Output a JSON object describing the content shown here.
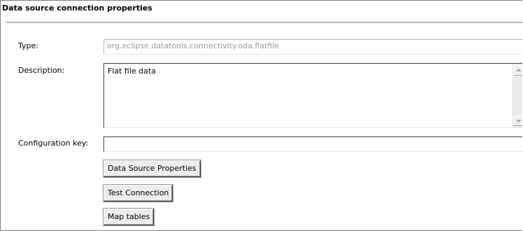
{
  "section": {
    "title": "Data source connection properties"
  },
  "type": {
    "label": "Type:",
    "value": "org.eclipse.datatools.connectivity.oda.flatfile"
  },
  "description": {
    "label": "Description:",
    "value": "Flat file data"
  },
  "configuration_key": {
    "label": "Configuration key:",
    "value": ""
  },
  "buttons": {
    "data_source_properties": "Data Source Properties",
    "test_connection": "Test Connection",
    "map_tables": "Map tables"
  },
  "colors": {
    "title_rule": "#a6b4cc",
    "readonly_text": "#9a9a9a",
    "button_face": "#ededed"
  }
}
